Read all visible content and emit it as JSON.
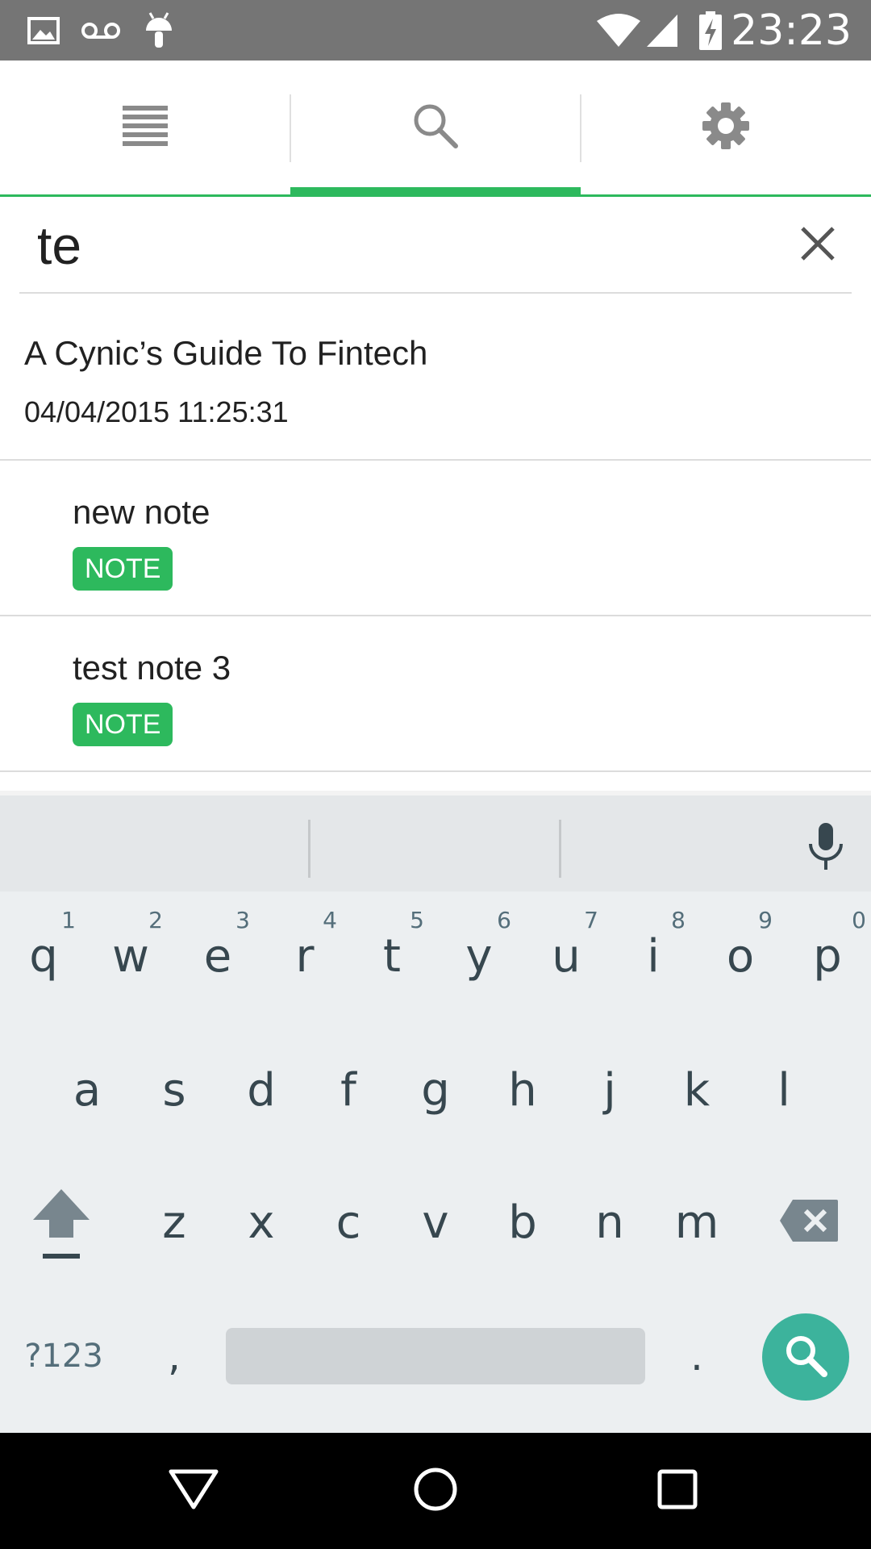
{
  "status_bar": {
    "time": "23:23",
    "icons": [
      "image-icon",
      "voicemail-icon",
      "android-icon",
      "wifi-icon",
      "signal-icon",
      "battery-charging-icon"
    ]
  },
  "tabs": [
    {
      "name": "notes-list",
      "icon": "list-icon",
      "selected": false
    },
    {
      "name": "search",
      "icon": "search-icon",
      "selected": true
    },
    {
      "name": "settings",
      "icon": "gear-icon",
      "selected": false
    }
  ],
  "colors": {
    "accent": "#2db95d",
    "search_key": "#3cb39c",
    "status_bar": "#757575"
  },
  "search": {
    "query": "te"
  },
  "results": [
    {
      "title": "A Cynic’s Guide To Fintech",
      "date": "04/04/2015 11:25:31"
    },
    {
      "title": "new note",
      "badge": "NOTE"
    },
    {
      "title": "test note 3",
      "badge": "NOTE"
    }
  ],
  "keyboard": {
    "row1": [
      "q",
      "w",
      "e",
      "r",
      "t",
      "y",
      "u",
      "i",
      "o",
      "p"
    ],
    "row1_hints": [
      "1",
      "2",
      "3",
      "4",
      "5",
      "6",
      "7",
      "8",
      "9",
      "0"
    ],
    "row2": [
      "a",
      "s",
      "d",
      "f",
      "g",
      "h",
      "j",
      "k",
      "l"
    ],
    "row3": [
      "z",
      "x",
      "c",
      "v",
      "b",
      "n",
      "m"
    ],
    "symbols_label": "?123",
    "comma": ",",
    "period": "."
  }
}
